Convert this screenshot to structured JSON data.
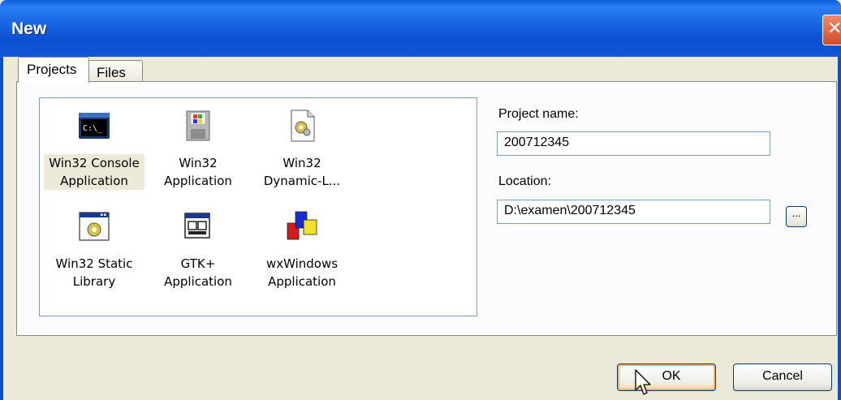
{
  "window": {
    "title": "New"
  },
  "tabs": [
    {
      "label": "Projects",
      "active": true
    },
    {
      "label": "Files",
      "active": false
    }
  ],
  "templates": [
    {
      "line1": "Win32 Console",
      "line2": "Application",
      "icon": "console-icon",
      "selected": true
    },
    {
      "line1": "Win32",
      "line2": "Application",
      "icon": "floppy-app-icon",
      "selected": false
    },
    {
      "line1": "Win32",
      "line2": "Dynamic-L...",
      "icon": "gear-document-icon",
      "selected": false
    },
    {
      "line1": "Win32 Static",
      "line2": "Library",
      "icon": "gear-window-icon",
      "selected": false
    },
    {
      "line1": "GTK+",
      "line2": "Application",
      "icon": "windows-stack-icon",
      "selected": false
    },
    {
      "line1": "wxWindows",
      "line2": "Application",
      "icon": "color-blocks-icon",
      "selected": false
    }
  ],
  "project_name": {
    "label": "Project name:",
    "value": "200712345"
  },
  "location": {
    "label": "Location:",
    "value": "D:\\examen\\200712345",
    "browse_label": "..."
  },
  "buttons": {
    "ok": "OK",
    "cancel": "Cancel"
  },
  "colors": {
    "titlebar": "#0b4fd0",
    "dialog_bg": "#ece9d8",
    "selection": "#ece9d8",
    "focus": "#f8b34a"
  }
}
